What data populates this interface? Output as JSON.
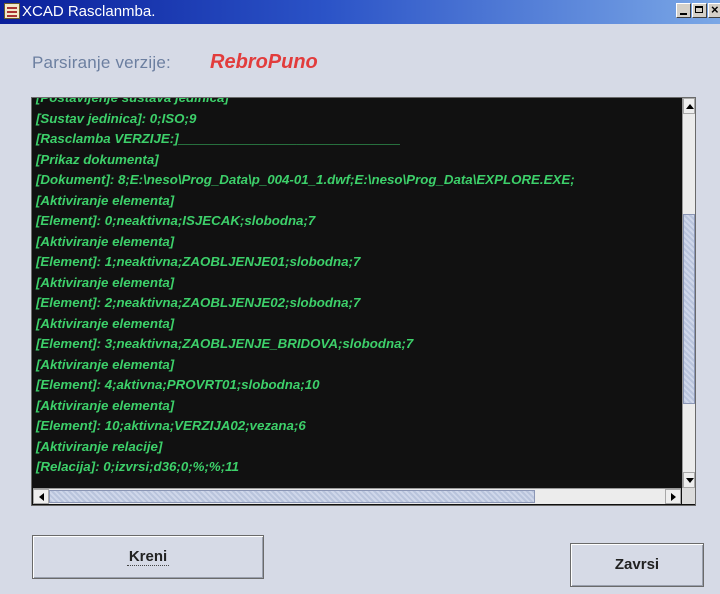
{
  "window": {
    "title": "XCAD Rasclanmba.",
    "icon": "app-icon"
  },
  "header": {
    "label": "Parsiranje verzije:",
    "version_name": "RebroPuno"
  },
  "console": {
    "lines": [
      "[Postavljenje sustava jedinica]",
      "[Sustav jedinica]: 0;ISO;9",
      "[Rasclamba VERZIJE:]______________________________",
      "[Prikaz dokumenta]",
      "[Dokument]: 8;E:\\neso\\Prog_Data\\p_004-01_1.dwf;E:\\neso\\Prog_Data\\EXPLORE.EXE;",
      "[Aktiviranje elementa]",
      "[Element]: 0;neaktivna;ISJECAK;slobodna;7",
      "[Aktiviranje elementa]",
      "[Element]: 1;neaktivna;ZAOBLJENJE01;slobodna;7",
      "[Aktiviranje elementa]",
      "[Element]: 2;neaktivna;ZAOBLJENJE02;slobodna;7",
      "[Aktiviranje elementa]",
      "[Element]: 3;neaktivna;ZAOBLJENJE_BRIDOVA;slobodna;7",
      "[Aktiviranje elementa]",
      "[Element]: 4;aktivna;PROVRT01;slobodna;10",
      "[Aktiviranje elementa]",
      "[Element]: 10;aktivna;VERZIJA02;vezana;6",
      "[Aktiviranje relacije]",
      "[Relacija]: 0;izvrsi;d36;0;%;%;11"
    ],
    "text_color": "#3dd06a",
    "background": "#111111"
  },
  "buttons": {
    "start_label": "Kreni",
    "finish_label": "Zavrsi"
  },
  "colors": {
    "title_bar": "#0a1f9a",
    "version_name": "#e23c3c",
    "label": "#6c7fa0",
    "window_bg": "#d6dae6"
  }
}
